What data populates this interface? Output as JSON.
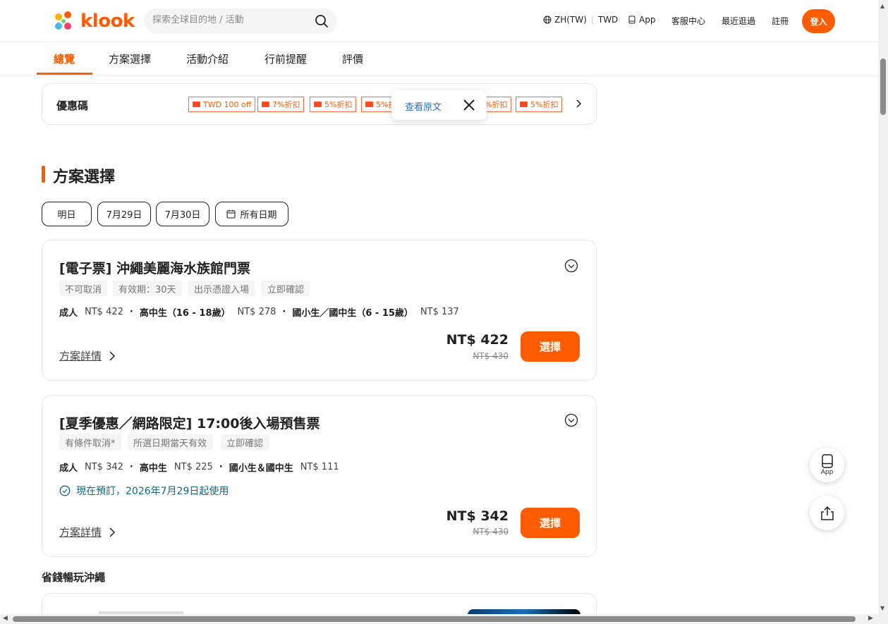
{
  "header": {
    "logo_text": "klook",
    "search_placeholder": "探索全球目的地 / 活動",
    "language": "ZH(TW)",
    "currency": "TWD",
    "app": "App",
    "help": "客服中心",
    "recent": "最近逛過",
    "register": "註冊",
    "login": "登入"
  },
  "tabs": [
    "總覽",
    "方案選擇",
    "活動介紹",
    "行前提醒",
    "評價"
  ],
  "promo": {
    "label": "優惠碼",
    "coupons": [
      "TWD 100 off",
      "7%折扣",
      "5%折扣",
      "5%折扣",
      "5%折扣",
      "5%折扣"
    ],
    "translate_link": "查看原文"
  },
  "section": {
    "title": "方案選擇",
    "dates": [
      "明日",
      "7月29日",
      "7月30日",
      "所有日期"
    ]
  },
  "packages": [
    {
      "title": "[電子票] 沖繩美麗海水族館門票",
      "tags": [
        "不可取消",
        "有效期：30天",
        "出示憑證入場",
        "立即確認"
      ],
      "prices": [
        {
          "label": "成人",
          "price": "NT$ 422"
        },
        {
          "label": "高中生（16 - 18歲）",
          "price": "NT$ 278"
        },
        {
          "label": "國小生／國中生（6 - 15歲）",
          "price": "NT$ 137"
        }
      ],
      "details": "方案詳情",
      "price": "NT$ 422",
      "original_price": "NT$ 430",
      "select": "選擇"
    },
    {
      "title": "[夏季優惠／網路限定] 17:00後入場預售票",
      "tags": [
        "有條件取消*",
        "所選日期當天有效",
        "立即確認"
      ],
      "prices": [
        {
          "label": "成人",
          "price": "NT$ 342"
        },
        {
          "label": "高中生",
          "price": "NT$ 225"
        },
        {
          "label": "國小生＆國中生",
          "price": "NT$ 111"
        }
      ],
      "notice": "現在預訂，2026年7月29日起使用",
      "details": "方案詳情",
      "price": "NT$ 342",
      "original_price": "NT$ 430",
      "select": "選擇"
    }
  ],
  "subheading": "省錢暢玩沖繩",
  "fab": {
    "app_label": "App"
  },
  "colors": {
    "brand": "#ff5b00",
    "notice": "#16687c",
    "link": "#2f6fd1"
  }
}
